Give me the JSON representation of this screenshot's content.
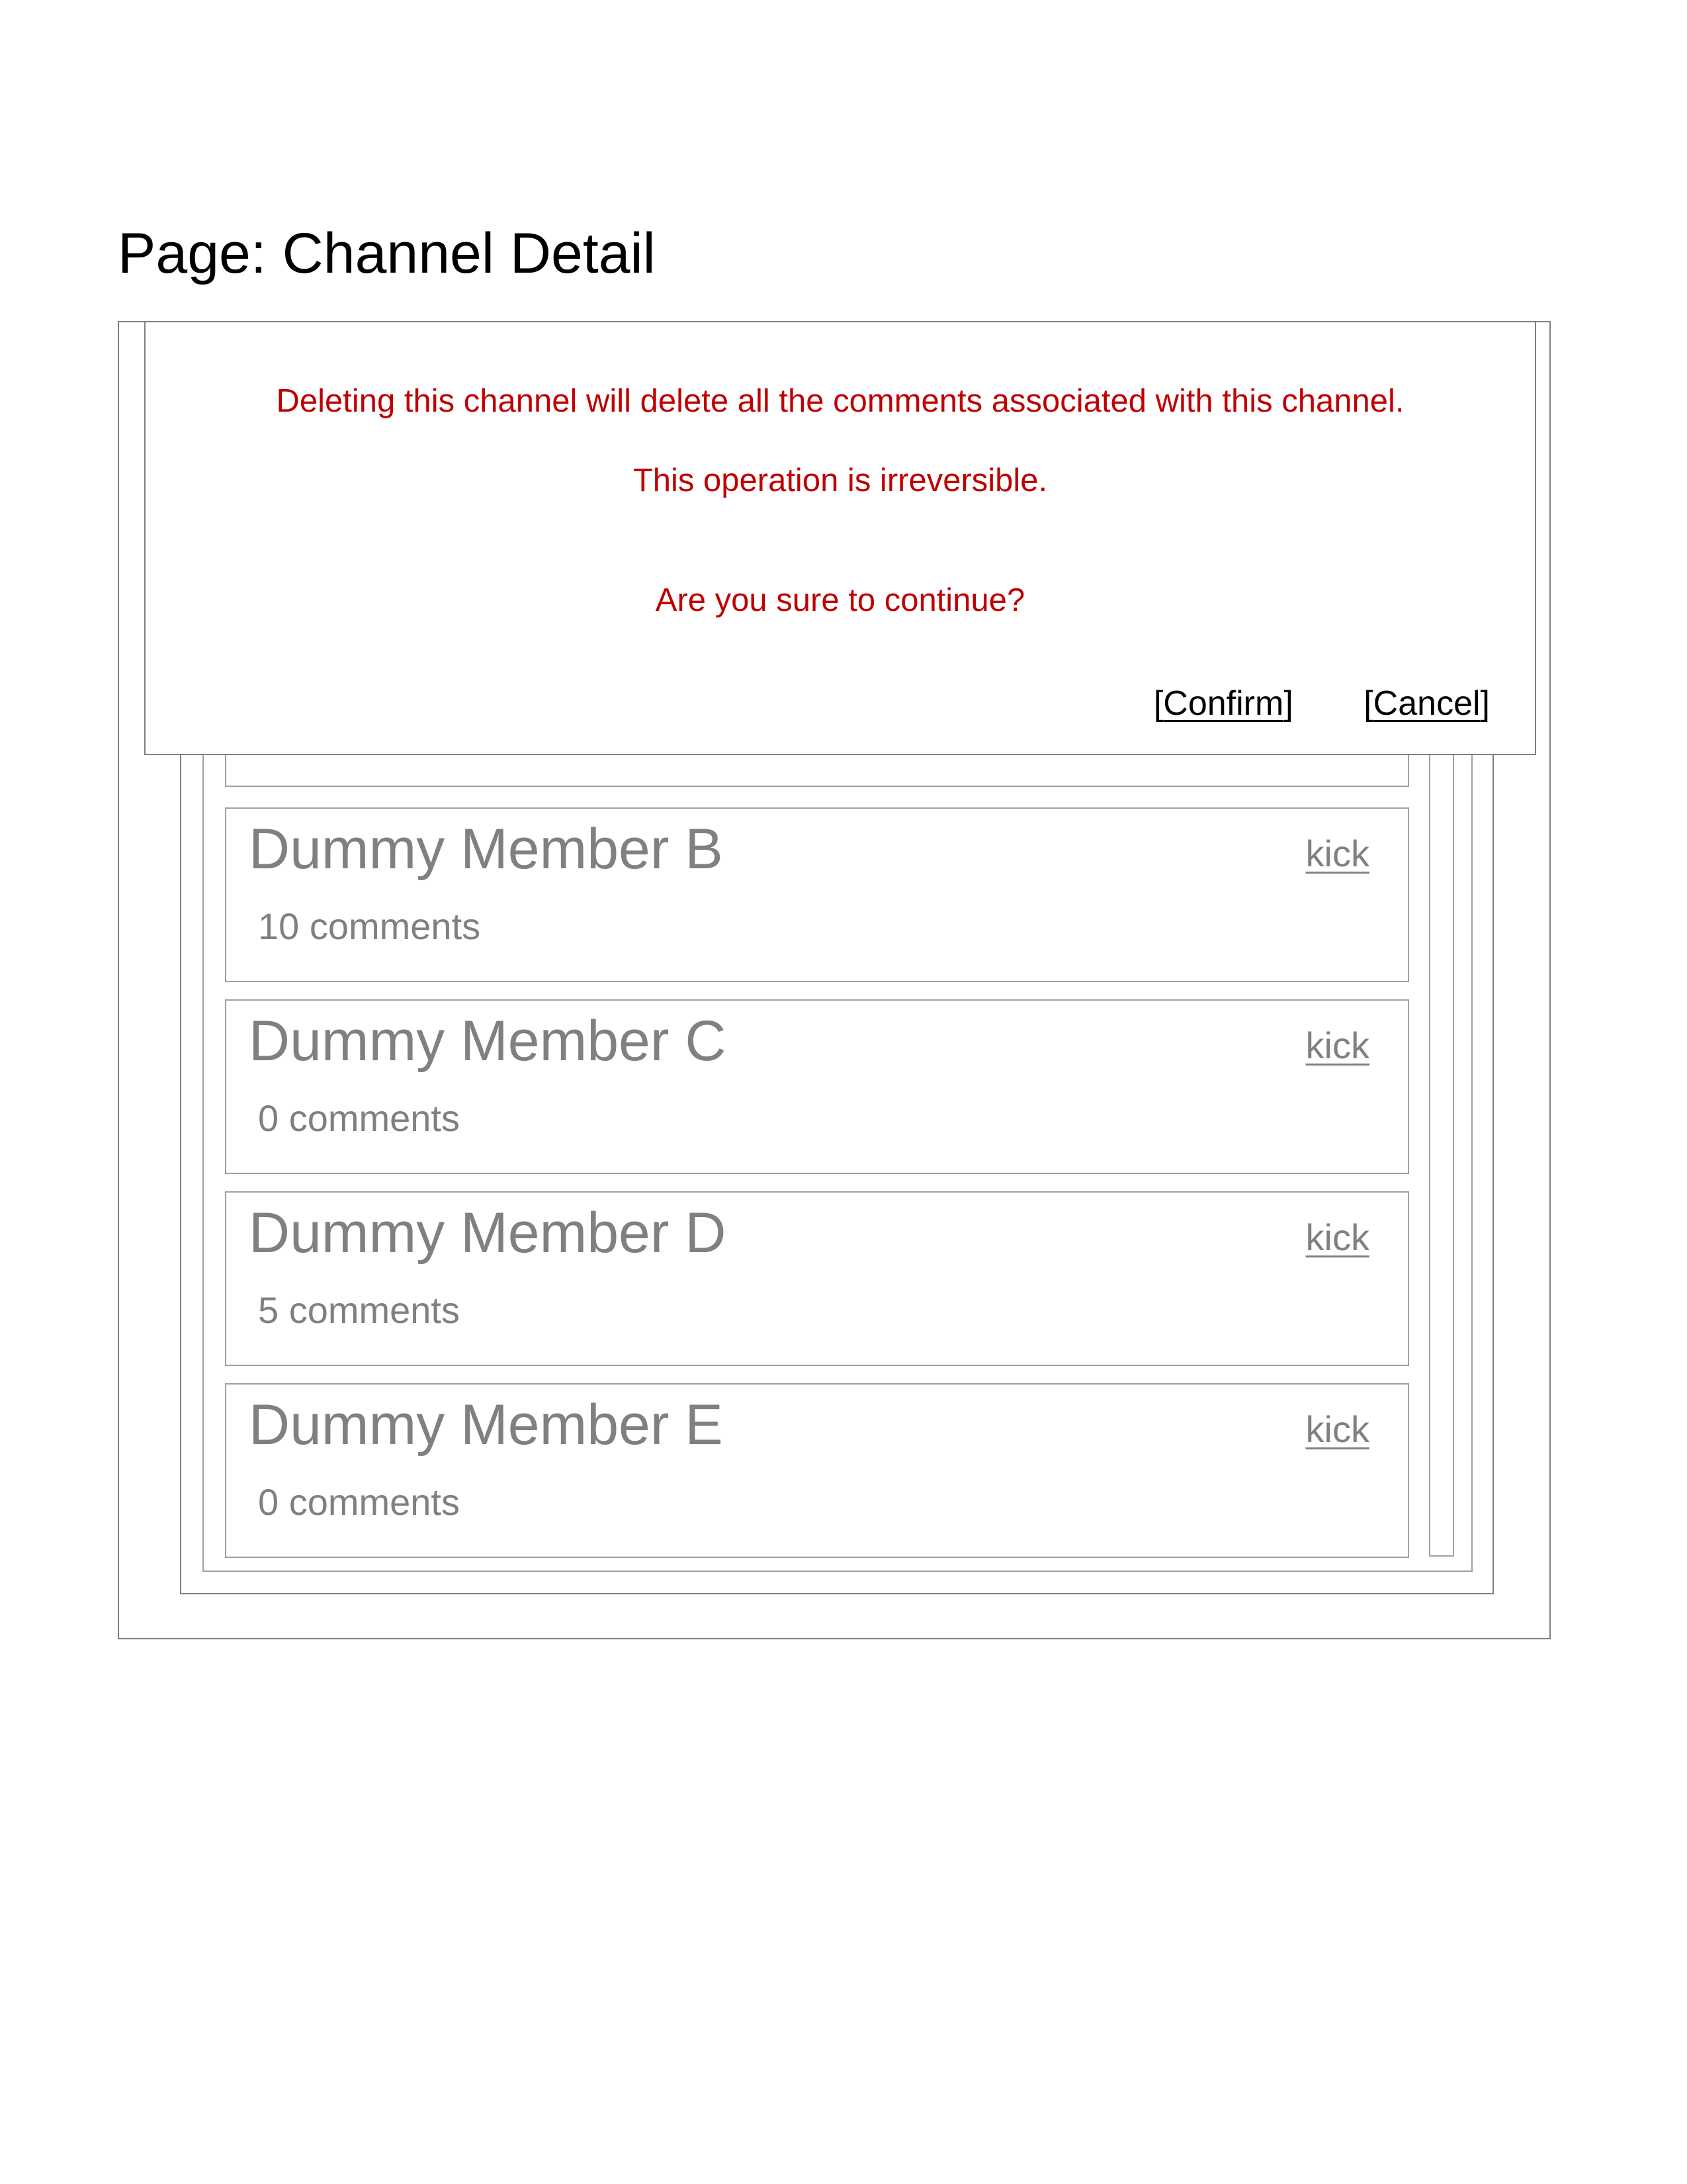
{
  "page": {
    "title": "Page: Channel Detail"
  },
  "members": [
    {
      "name": "Dummy Member B",
      "comments": "10 comments",
      "kick_label": "kick"
    },
    {
      "name": "Dummy Member C",
      "comments": "0 comments",
      "kick_label": "kick"
    },
    {
      "name": "Dummy Member D",
      "comments": "5 comments",
      "kick_label": "kick"
    },
    {
      "name": "Dummy Member E",
      "comments": "0 comments",
      "kick_label": "kick"
    }
  ],
  "modal": {
    "message_1": "Deleting this channel will delete all the comments associated with this channel.",
    "message_2": "This operation is irreversible.",
    "message_3": "Are you sure to continue?",
    "confirm_label": "Confirm",
    "cancel_label": "Cancel",
    "bracket_open": "[",
    "bracket_close": "]"
  },
  "colors": {
    "warning_text": "#c00000",
    "muted_text": "#808080",
    "border": "#808080",
    "light_border": "#a0a0a0"
  }
}
